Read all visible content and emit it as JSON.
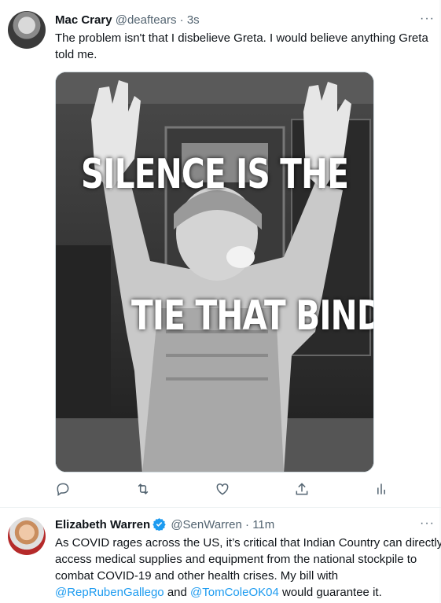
{
  "tweets": [
    {
      "author_name": "Mac Crary",
      "handle": "@deaftears",
      "separator": "·",
      "time": "3s",
      "text": "The problem isn't that I disbelieve Greta.  I would believe anything Greta told me.",
      "media": {
        "caption_top": "SILENCE IS THE",
        "caption_bottom": "TIE THAT BINDS"
      },
      "actions": [
        "reply-icon",
        "retweet-icon",
        "like-icon",
        "share-icon",
        "analytics-icon"
      ]
    },
    {
      "author_name": "Elizabeth Warren",
      "verified": true,
      "handle": "@SenWarren",
      "separator": "·",
      "time": "11m",
      "text_parts": {
        "p1": "As COVID rages across the US, it’s critical that Indian Country can directly access medical supplies and equipment from the national stockpile to combat COVID-19 and other health crises. My bill with ",
        "mention1": "@RepRubenGallego",
        "p2": " and ",
        "mention2": "@TomColeOK04",
        "p3": " would guarantee it."
      }
    }
  ],
  "more_label": "···",
  "colors": {
    "accent": "#1d9bf0",
    "secondary_text": "#536471",
    "border": "#eff3f4"
  }
}
